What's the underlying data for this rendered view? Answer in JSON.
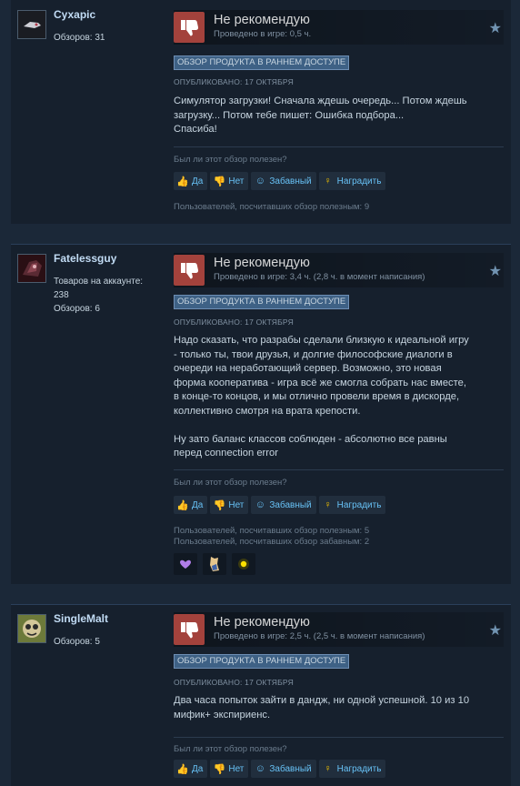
{
  "reviews": [
    {
      "author": "Сухаріс",
      "stats": [
        "Обзоров: 31"
      ],
      "verdict": "Не рекомендую",
      "played": "Проведено в игре: 0,5 ч.",
      "badge": "ОБЗОР ПРОДУКТА В РАННЕМ ДОСТУПЕ",
      "posted": "ОПУБЛИКОВАНО: 17 ОКТЯБРЯ",
      "text": "Симулятор загрузки! Сначала ждешь очередь... Потом ждешь\nзагрузку... Потом тебе пишет: Ошибка подбора...\nСпасиба!",
      "helpful_question": "Был ли этот обзор полезен?",
      "buttons": {
        "yes": "Да",
        "no": "Нет",
        "funny": "Забавный",
        "award": "Наградить"
      },
      "helpful_stats": [
        "Пользователей, посчитавших обзор полезным: 9"
      ]
    },
    {
      "author": "Fatelessguy",
      "stats": [
        "Товаров на аккаунте:",
        "238",
        "Обзоров: 6"
      ],
      "verdict": "Не рекомендую",
      "played": "Проведено в игре: 3,4 ч. (2,8 ч. в момент написания)",
      "badge": "ОБЗОР ПРОДУКТА В РАННЕМ ДОСТУПЕ",
      "posted": "ОПУБЛИКОВАНО: 17 ОКТЯБРЯ",
      "text": "Надо сказать, что разрабы сделали близкую к идеальной игру\n- только ты, твои друзья, и долгие философские диалоги в\nочереди на неработающий сервер. Возможно, это новая\nформа кооператива - игра всё же смогла собрать нас вместе,\nв конце-то концов, и мы отлично провели время в дискорде,\nколлективно смотря на врата крепости.\n\nНу зато баланс классов соблюден - абсолютно все равны\nперед connection error",
      "helpful_question": "Был ли этот обзор полезен?",
      "buttons": {
        "yes": "Да",
        "no": "Нет",
        "funny": "Забавный",
        "award": "Наградить"
      },
      "helpful_stats": [
        "Пользователей, посчитавших обзор полезным: 5",
        "Пользователей, посчитавших обзор забавным: 2"
      ]
    },
    {
      "author": "SingleMalt",
      "stats": [
        "Обзоров: 5"
      ],
      "verdict": "Не рекомендую",
      "played": "Проведено в игре: 2,5 ч. (2,5 ч. в момент написания)",
      "badge": "ОБЗОР ПРОДУКТА В РАННЕМ ДОСТУПЕ",
      "posted": "ОПУБЛИКОВАНО: 17 ОКТЯБРЯ",
      "text": "Два часа попыток зайти в дандж, ни одной успешной. 10 из 10\nмифик+ экспириенс.",
      "helpful_question": "Был ли этот обзор полезен?",
      "buttons": {
        "yes": "Да",
        "no": "Нет",
        "funny": "Забавный",
        "award": "Наградить"
      },
      "helpful_stats": []
    }
  ],
  "icons": {
    "thumb_down": "thumbs-down-icon",
    "thumb_up_small": "thumbs-up-icon",
    "thumb_down_small": "thumbs-down-icon",
    "funny": "smiley-icon",
    "award": "award-icon",
    "star": "star-icon"
  },
  "colors": {
    "background": "#1b2838",
    "card": "#16202d",
    "thumb_down": "#a3423c",
    "link": "#67c1f5",
    "badge": "#3e6185"
  }
}
